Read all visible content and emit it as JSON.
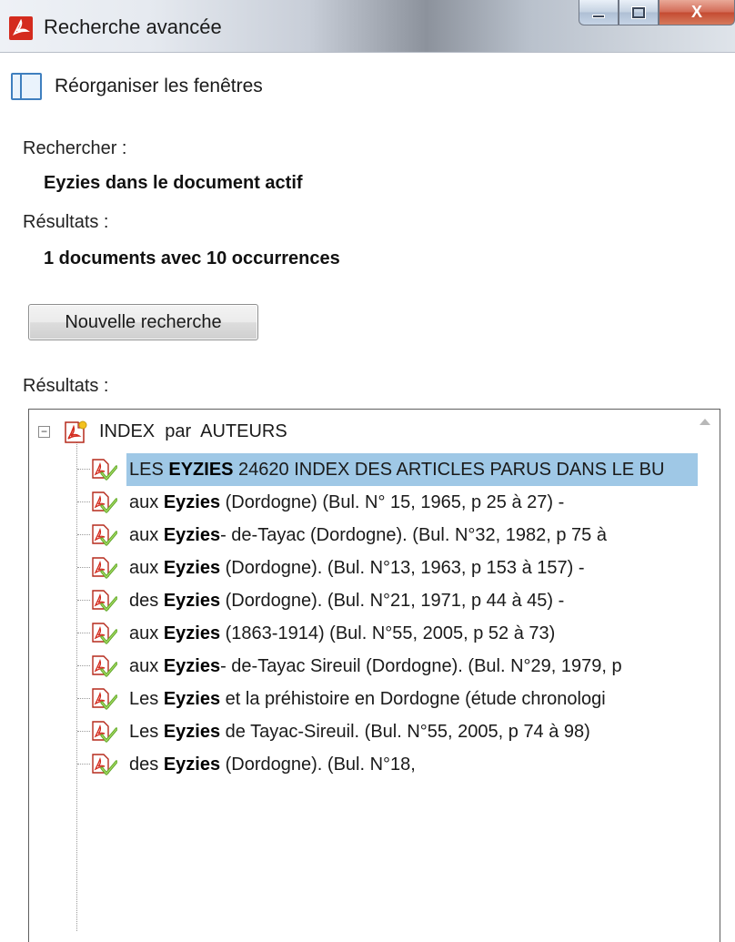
{
  "window": {
    "title": "Recherche avancée",
    "close_glyph": "X"
  },
  "toolbar": {
    "reorganize_label": "Réorganiser les fenêtres"
  },
  "search": {
    "label": "Rechercher :",
    "query": "Eyzies dans le document actif"
  },
  "summary": {
    "label": "Résultats :",
    "text": "1 documents avec 10 occurrences"
  },
  "buttons": {
    "new_search": "Nouvelle recherche"
  },
  "results": {
    "label": "Résultats :",
    "root": {
      "label": "INDEX  par  AUTEURS",
      "expander": "−"
    },
    "items": [
      {
        "before": "LES ",
        "term": "EYZIES",
        "after": " 24620 INDEX DES ARTICLES PARUS DANS LE BU",
        "selected": true
      },
      {
        "before": "aux ",
        "term": "Eyzies",
        "after": " (Dordogne) (Bul. N° 15, 1965, p 25 à 27) -",
        "selected": false
      },
      {
        "before": "aux ",
        "term": "Eyzies",
        "after": "- de-Tayac (Dordogne). (Bul. N°32, 1982, p 75 à",
        "selected": false
      },
      {
        "before": "aux ",
        "term": "Eyzies",
        "after": " (Dordogne). (Bul. N°13, 1963, p 153 à 157) -",
        "selected": false
      },
      {
        "before": "des ",
        "term": "Eyzies",
        "after": " (Dordogne). (Bul. N°21, 1971, p 44 à 45) -",
        "selected": false
      },
      {
        "before": "aux ",
        "term": "Eyzies",
        "after": " (1863-1914) (Bul. N°55, 2005, p 52 à 73)",
        "selected": false
      },
      {
        "before": "aux ",
        "term": "Eyzies",
        "after": "- de-Tayac Sireuil (Dordogne). (Bul. N°29, 1979, p",
        "selected": false
      },
      {
        "before": "Les ",
        "term": "Eyzies",
        "after": " et la préhistoire en Dordogne (étude chronologi",
        "selected": false
      },
      {
        "before": "Les ",
        "term": "Eyzies",
        "after": " de Tayac-Sireuil. (Bul. N°55, 2005, p 74 à 98)",
        "selected": false
      },
      {
        "before": "des ",
        "term": "Eyzies",
        "after": " (Dordogne). (Bul. N°18,",
        "selected": false
      }
    ]
  }
}
